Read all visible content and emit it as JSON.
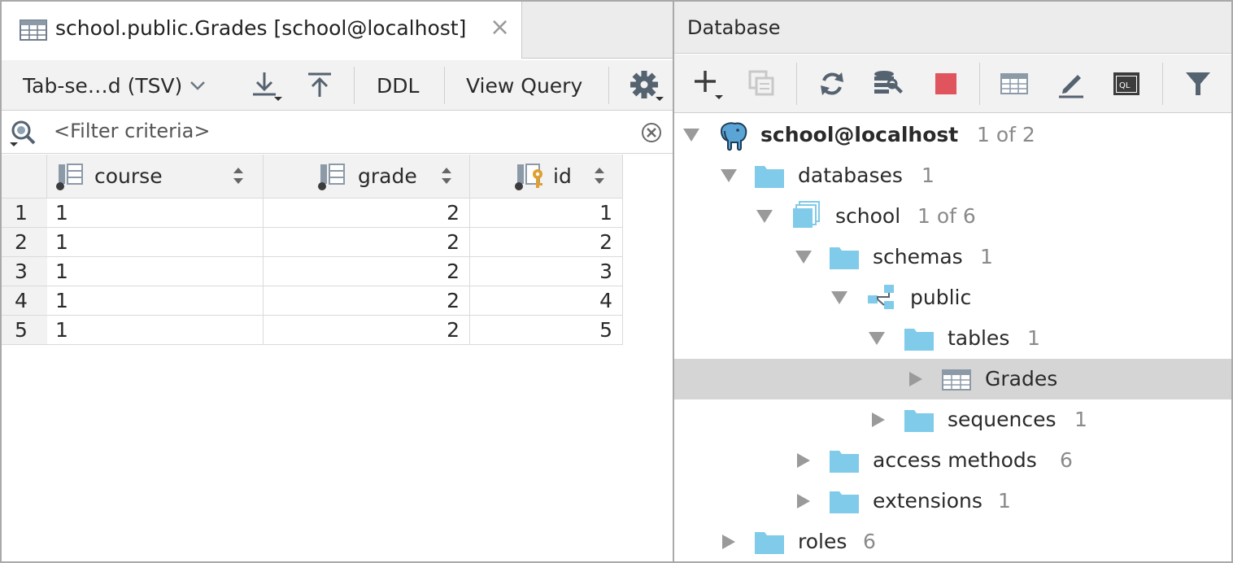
{
  "editor": {
    "tab_title": "school.public.Grades [school@localhost]",
    "tab_close": "×",
    "toolbar": {
      "format_label": "Tab-se…d (TSV)",
      "ddl_label": "DDL",
      "view_query_label": "View Query"
    },
    "filter_placeholder": "<Filter criteria>",
    "columns": [
      "course",
      "grade",
      "id"
    ],
    "rows": [
      {
        "num": "1",
        "course": "1",
        "grade": "2",
        "id": "1"
      },
      {
        "num": "2",
        "course": "1",
        "grade": "2",
        "id": "2"
      },
      {
        "num": "3",
        "course": "1",
        "grade": "2",
        "id": "3"
      },
      {
        "num": "4",
        "course": "1",
        "grade": "2",
        "id": "4"
      },
      {
        "num": "5",
        "course": "1",
        "grade": "2",
        "id": "5"
      }
    ]
  },
  "database_panel": {
    "title": "Database",
    "toolbar_icons": [
      "add-icon",
      "duplicate-icon",
      "refresh-icon",
      "schema-settings-icon",
      "stop-icon",
      "table-view-icon",
      "edit-icon",
      "query-console-icon",
      "filter-icon"
    ],
    "tree": [
      {
        "label": "school@localhost",
        "count": "1 of 2",
        "icon": "postgresql-elephant-icon",
        "expanded": true,
        "bold": true
      },
      {
        "label": "databases",
        "count": "1",
        "icon": "folder-icon",
        "expanded": true
      },
      {
        "label": "school",
        "count": "1 of 6",
        "icon": "database-icon",
        "expanded": true
      },
      {
        "label": "schemas",
        "count": "1",
        "icon": "folder-icon",
        "expanded": true
      },
      {
        "label": "public",
        "count": "",
        "icon": "schema-icon",
        "expanded": true
      },
      {
        "label": "tables",
        "count": "1",
        "icon": "folder-icon",
        "expanded": true
      },
      {
        "label": "Grades",
        "count": "",
        "icon": "table-icon",
        "expanded": false,
        "selected": true
      },
      {
        "label": "sequences",
        "count": "1",
        "icon": "folder-icon",
        "expanded": false
      },
      {
        "label": "access methods",
        "count": "6",
        "icon": "folder-icon",
        "expanded": false
      },
      {
        "label": "extensions",
        "count": "1",
        "icon": "folder-icon",
        "expanded": false
      },
      {
        "label": "roles",
        "count": "6",
        "icon": "folder-icon",
        "expanded": false
      }
    ]
  },
  "colors": {
    "folder": "#7fcbe9",
    "stop": "#e0545d",
    "key": "#e0a030",
    "selection": "#d5d5d5"
  }
}
